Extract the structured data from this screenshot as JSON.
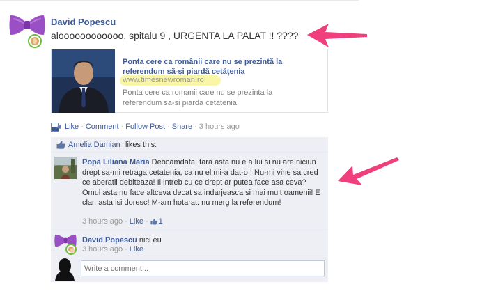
{
  "post": {
    "author": "David Popescu",
    "message": "aloooooooooooo, spitalu 9 , URGENTA LA PALAT !! ????",
    "shared_link": {
      "title": "Ponta cere ca românii care nu se prezintă la referendum să-şi piardă cetăţenia",
      "url": "www.timesnewroman.ro",
      "description": "Ponta cere ca romanii care nu se prezinta la referendum sa-si piarda cetatenia"
    },
    "actions": {
      "like": "Like",
      "comment": "Comment",
      "follow": "Follow Post",
      "share": "Share",
      "time": "3 hours ago"
    }
  },
  "likes": {
    "name": "Amelia Damian",
    "text": "likes this."
  },
  "comments": [
    {
      "author": "Popa Liliana Maria",
      "text": "Deocamdata, tara asta nu e a lui si nu are niciun drept sa-mi retraga cetatenia, ca nu el mi-a dat-o ! Nu-mi vine sa cred ce aberatii debiteaza! Il intreb cu ce drept ar putea face asa ceva? Omul asta nu face altceva decat sa indarjeasca si mai mult oamenii! E clar, asta isi doresc! M-am hotarat: nu merg la referendum!",
      "time": "3 hours ago",
      "like": "Like",
      "like_count": "1"
    },
    {
      "author": "David Popescu",
      "text": "nici eu",
      "time": "3 hours ago",
      "like": "Like"
    }
  ],
  "comment_box": {
    "placeholder": "Write a comment..."
  },
  "colors": {
    "link": "#3b5998",
    "muted": "#999999",
    "ufi_background": "#edeff4",
    "annotation_arrow": "#ef3f7c",
    "url_highlight": "#f7f48a"
  },
  "icons": [
    "bowtie-avatar",
    "profile-badge",
    "share-icon",
    "thumbs-up-icon",
    "annotation-arrow"
  ]
}
